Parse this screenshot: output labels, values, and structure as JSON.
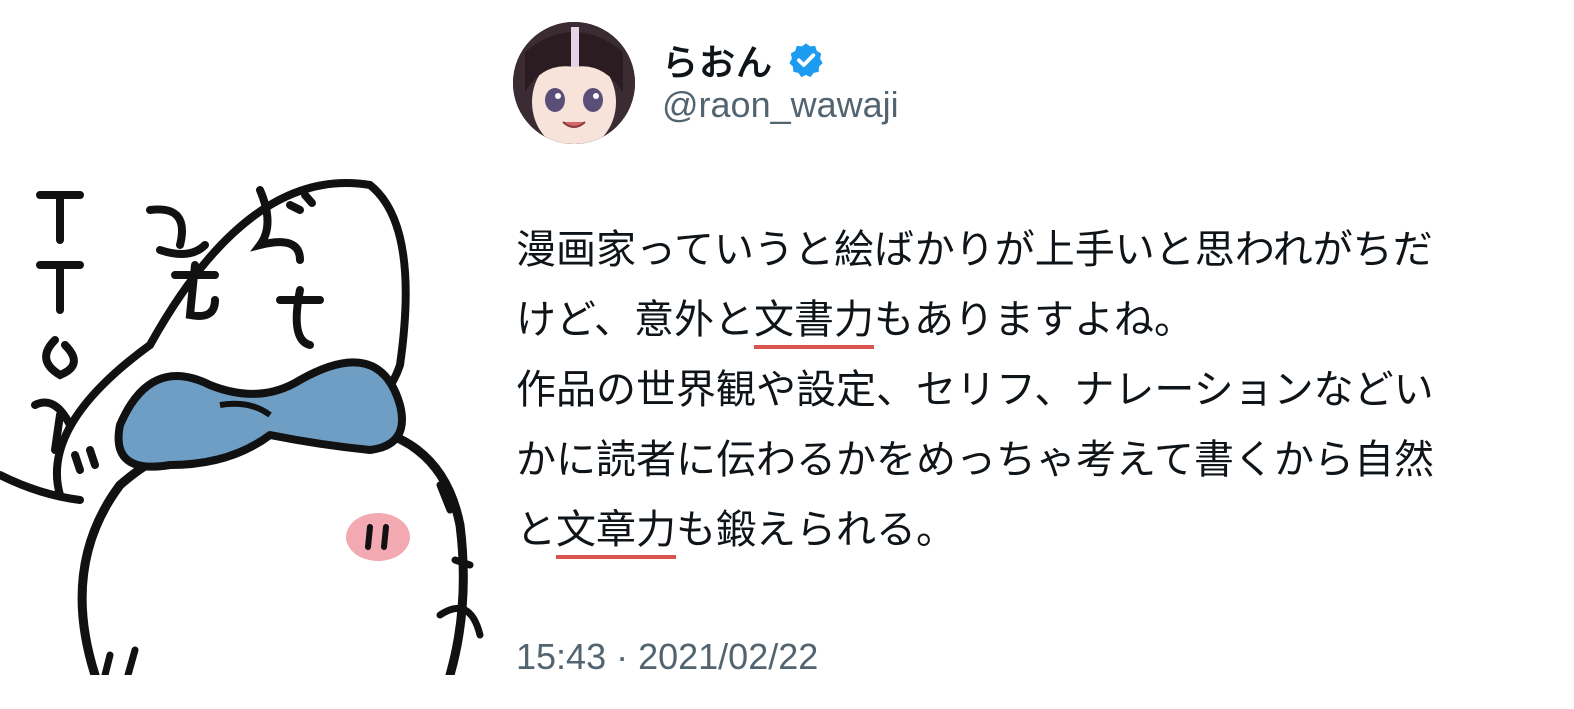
{
  "user": {
    "display_name": "らおん",
    "handle": "@raon_wawaji",
    "verified_color": "#1d9bf0"
  },
  "tweet": {
    "line1": "漫画家っていうと絵ばかりが上手いと思われがちだ",
    "line2_before": "けど、意外と",
    "line2_highlight": "文書力",
    "line2_after": "もありますよね。",
    "line3": "作品の世界観や設定、セリフ、ナレーションなどい",
    "line4": "かに読者に伝わるかをめっちゃ考えて書くから自然",
    "line5_before": "と",
    "line5_highlight": "文章力",
    "line5_after": "も鍛えられる。"
  },
  "meta": {
    "time": "15:43",
    "separator": "·",
    "date": "2021/02/22"
  },
  "illustration": {
    "handwritten_text": "どっちでもTTのかッ",
    "ribbon_color": "#6f9ec4",
    "cheek_color": "#f2a9b1"
  },
  "colors": {
    "highlight_underline": "#d9534f",
    "secondary_text": "#536471"
  }
}
